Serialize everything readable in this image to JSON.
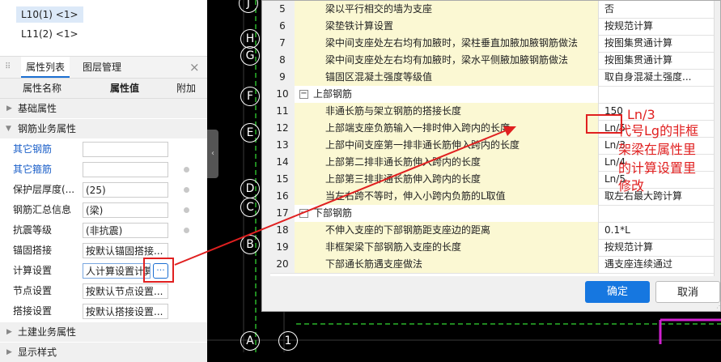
{
  "floors": {
    "items": [
      {
        "label": "L10(1) <1>"
      },
      {
        "label": "L11(2) <1>"
      }
    ]
  },
  "panel": {
    "tab_props": "属性列表",
    "tab_layers": "图层管理",
    "close": "×",
    "col_name": "属性名称",
    "col_value": "属性值",
    "col_extra": "附加",
    "group_basic": "基础属性",
    "group_rebar": "钢筋业务属性",
    "group_civil": "土建业务属性",
    "group_display": "显示样式",
    "rows": [
      {
        "name": "其它钢筋",
        "value": ""
      },
      {
        "name": "其它箍筋",
        "value": ""
      },
      {
        "name": "保护层厚度(...",
        "value": "(25)"
      },
      {
        "name": "钢筋汇总信息",
        "value": "(梁)"
      },
      {
        "name": "抗震等级",
        "value": "(非抗震)"
      },
      {
        "name": "锚固搭接",
        "value": "按默认锚固搭接..."
      },
      {
        "name": "计算设置",
        "value": "人计算设置计算"
      },
      {
        "name": "节点设置",
        "value": "按默认节点设置..."
      },
      {
        "name": "搭接设置",
        "value": "按默认搭接设置..."
      }
    ]
  },
  "axis_labels": [
    "J",
    "H",
    "G",
    "F",
    "E",
    "D",
    "C",
    "B",
    "A",
    "1"
  ],
  "table": {
    "rows": [
      {
        "num": "5",
        "name": "梁以平行相交的墙为支座",
        "value": "否",
        "group": false
      },
      {
        "num": "6",
        "name": "梁垫铁计算设置",
        "value": "按规范计算",
        "group": false
      },
      {
        "num": "7",
        "name": "梁中间支座处左右均有加腋时，梁柱垂直加腋加腋钢筋做法",
        "value": "按图集贯通计算",
        "group": false
      },
      {
        "num": "8",
        "name": "梁中间支座处左右均有加腋时，梁水平侧腋加腋钢筋做法",
        "value": "按图集贯通计算",
        "group": false
      },
      {
        "num": "9",
        "name": "锚固区混凝土强度等级值",
        "value": "取自身混凝土强度...",
        "group": false
      },
      {
        "num": "10",
        "name": "上部钢筋",
        "value": "",
        "group": true
      },
      {
        "num": "11",
        "name": "非通长筋与架立钢筋的搭接长度",
        "value": "150",
        "group": false
      },
      {
        "num": "12",
        "name": "上部端支座负筋输入一排时伸入跨内的长度",
        "value": "Ln/5",
        "group": false
      },
      {
        "num": "13",
        "name": "上部中间支座第一排非通长筋伸入跨内的长度",
        "value": "Ln/3",
        "group": false
      },
      {
        "num": "14",
        "name": "上部第二排非通长筋伸入跨内的长度",
        "value": "Ln/4",
        "group": false
      },
      {
        "num": "15",
        "name": "上部第三排非通长筋伸入跨内的长度",
        "value": "Ln/5",
        "group": false
      },
      {
        "num": "16",
        "name": "当左右跨不等时，伸入小跨内负筋的L取值",
        "value": "取左右最大跨计算",
        "group": false
      },
      {
        "num": "17",
        "name": "下部钢筋",
        "value": "",
        "group": true
      },
      {
        "num": "18",
        "name": "不伸入支座的下部钢筋距支座边的距离",
        "value": "0.1*L",
        "group": false
      },
      {
        "num": "19",
        "name": "非框架梁下部钢筋入支座的长度",
        "value": "按规范计算",
        "group": false
      },
      {
        "num": "20",
        "name": "下部通长筋遇支座做法",
        "value": "遇支座连续通过",
        "group": false
      }
    ]
  },
  "dialog": {
    "ok": "确定",
    "cancel": "取消"
  },
  "annotation": {
    "line1": "Ln/3",
    "line2": "代号Lg的非框",
    "line3": "架梁在属性里",
    "line4": "的计算设置里",
    "line5": "修改",
    "color": "#e02020"
  }
}
